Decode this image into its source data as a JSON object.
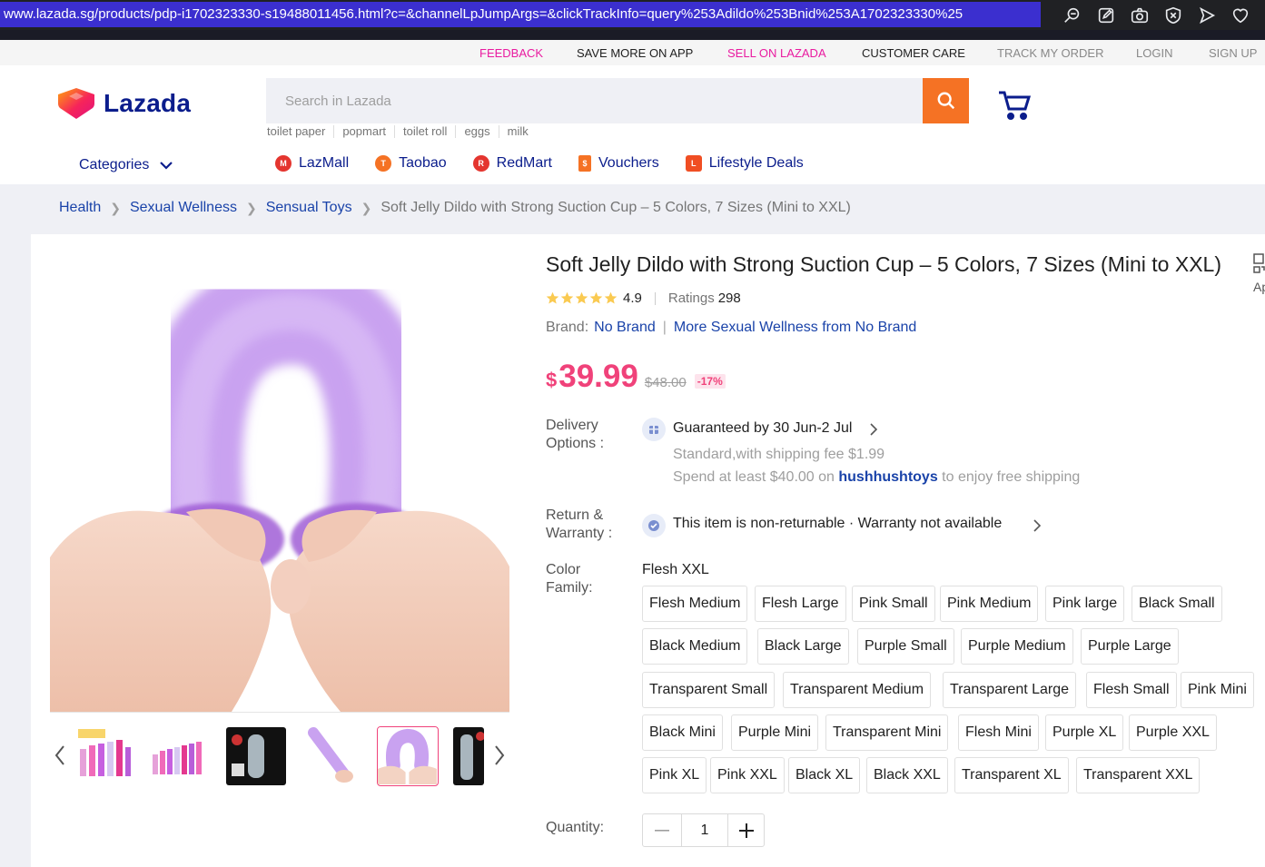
{
  "browser": {
    "url": "www.lazada.sg/products/pdp-i1702323330-s19488011456.html?c=&channelLpJumpArgs=&clickTrackInfo=query%253Adildo%253Bnid%253A1702323330%25",
    "icons": [
      "search-icon",
      "edit-icon",
      "camera-icon",
      "shield-icon",
      "send-icon",
      "heart-icon"
    ]
  },
  "top_nav": {
    "feedback": "FEEDBACK",
    "save_more": "SAVE MORE ON APP",
    "sell": "SELL ON LAZADA",
    "customer_care": "CUSTOMER CARE",
    "track_order": "TRACK MY ORDER",
    "login": "LOGIN",
    "signup": "SIGN UP"
  },
  "header": {
    "logo_text": "Lazada",
    "search_placeholder": "Search in Lazada",
    "suggestions": [
      "toilet paper",
      "popmart",
      "toilet roll",
      "eggs",
      "milk"
    ],
    "categories": "Categories",
    "channels": [
      {
        "label": "LazMall",
        "icon": "lazmall-icon",
        "color": "#e4352f"
      },
      {
        "label": "Taobao",
        "icon": "taobao-icon",
        "color": "#f57224"
      },
      {
        "label": "RedMart",
        "icon": "redmart-icon",
        "color": "#e4352f"
      },
      {
        "label": "Vouchers",
        "icon": "voucher-icon",
        "color": "#f57224"
      },
      {
        "label": "Lifestyle Deals",
        "icon": "lifestyle-icon",
        "color": "#f04e23"
      }
    ]
  },
  "breadcrumb": {
    "items": [
      "Health",
      "Sexual Wellness",
      "Sensual Toys"
    ],
    "current": "Soft Jelly Dildo with Strong Suction Cup – 5 Colors, 7 Sizes (Mini to XXL)"
  },
  "product": {
    "title": "Soft Jelly Dildo with Strong Suction Cup – 5 Colors, 7 Sizes (Mini to XXL)",
    "rating": "4.9",
    "stars": 5,
    "ratings_label": "Ratings",
    "ratings_count": "298",
    "brand_label": "Brand:",
    "brand": "No Brand",
    "more_from": "More Sexual Wellness from No Brand",
    "currency": "$",
    "price": "39.99",
    "original_price": "$48.00",
    "discount": "-17%",
    "qr_label": "Ap"
  },
  "delivery": {
    "label_1": "Delivery",
    "label_2": "Options :",
    "guaranteed": "Guaranteed by 30 Jun-2 Jul",
    "standard": "Standard,with shipping fee $1.99",
    "free_prefix": "Spend at least $40.00 on",
    "shop": "hushhushtoys",
    "free_suffix": "to enjoy free shipping"
  },
  "warranty": {
    "label_1": "Return &",
    "label_2": "Warranty :",
    "text": "This item is non-returnable · Warranty not available"
  },
  "color_family": {
    "label_1": "Color",
    "label_2": "Family:",
    "selected": "Flesh XXL",
    "options": [
      "Flesh Medium",
      "Flesh Large",
      "Pink Small",
      "Pink Medium",
      "Pink large",
      "Black Small",
      "Black Medium",
      "Black Large",
      "Purple Small",
      "Purple Medium",
      "Purple Large",
      "Transparent Small",
      "Transparent Medium",
      "Transparent Large",
      "Flesh Small",
      "Pink Mini",
      "Black Mini",
      "Purple Mini",
      "Transparent Mini",
      "Flesh Mini",
      "Purple XL",
      "Purple XXL",
      "Pink XL",
      "Pink XXL",
      "Black XL",
      "Black XXL",
      "Transparent XL",
      "Transparent XXL"
    ]
  },
  "quantity": {
    "label": "Quantity:",
    "value": "1"
  },
  "colors": {
    "brand_pink": "#f0427a",
    "brand_orange": "#f57224",
    "link_blue": "#1a43a9",
    "nav_blue": "#0b1d8c"
  }
}
